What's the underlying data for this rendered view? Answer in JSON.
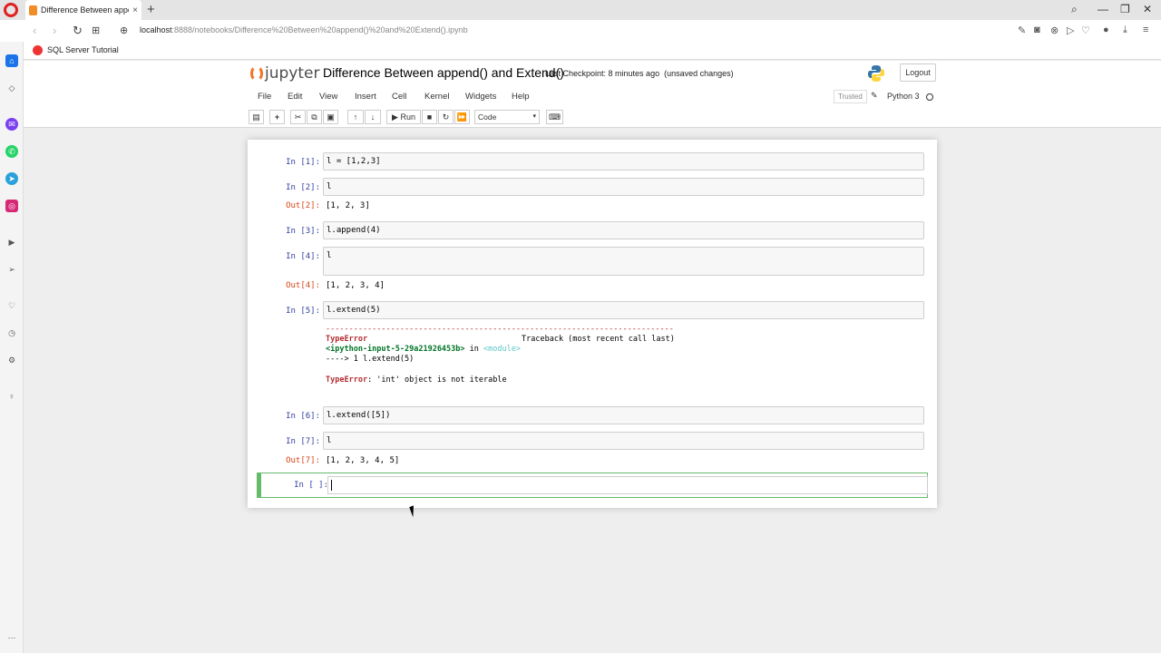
{
  "browser": {
    "tab_title": "Difference Between append",
    "tab_close": "×",
    "new_tab": "+",
    "url_host": "localhost",
    "url_path": ":8888/notebooks/Difference%20Between%20append()%20and%20Extend().ipynb",
    "bookmark": "SQL Server Tutorial",
    "window_controls": [
      "⌕",
      "—",
      "❐",
      "✕"
    ]
  },
  "jupyter": {
    "logo_text": "jupyter",
    "notebook_title": "Difference Between append() and Extend()",
    "checkpoint": "Last Checkpoint: 8 minutes ago",
    "unsaved": "(unsaved changes)",
    "logout_label": "Logout",
    "menu": [
      "File",
      "Edit",
      "View",
      "Insert",
      "Cell",
      "Kernel",
      "Widgets",
      "Help"
    ],
    "trusted_label": "Trusted",
    "kernel_name": "Python 3",
    "run_label": "Run",
    "cell_type": "Code"
  },
  "cells": [
    {
      "prompt": "In [1]:",
      "code": "l = [1,2,3]"
    },
    {
      "prompt": "In [2]:",
      "code": "l",
      "out_prompt": "Out[2]:",
      "output": "[1, 2, 3]"
    },
    {
      "prompt": "In [3]:",
      "code": "l.append(4)"
    },
    {
      "prompt": "In [4]:",
      "code": "l",
      "out_prompt": "Out[4]:",
      "output": "[1, 2, 3, 4]"
    },
    {
      "prompt": "In [5]:",
      "code": "l.extend(5)"
    },
    {
      "prompt": "In [6]:",
      "code": "l.extend([5])"
    },
    {
      "prompt": "In [7]:",
      "code": "l",
      "out_prompt": "Out[7]:",
      "output": "[1, 2, 3, 4, 5]"
    },
    {
      "prompt": "In [ ]:",
      "code": ""
    }
  ],
  "error": {
    "dashes": "---------------------------------------------------------------------------",
    "type": "TypeError",
    "traceback": "Traceback (most recent call last)",
    "location": "<ipython-input-5-29a21926453b>",
    "in_word": " in ",
    "module": "<module>",
    "arrow_line": "----> 1 l.extend(5)",
    "message_type": "TypeError",
    "message": ": 'int' object is not iterable"
  },
  "colors": {
    "in_prompt": "#303f9f",
    "out_prompt": "#d84315",
    "active_cell_border": "#66bb6a",
    "jupyter_orange": "#f37626"
  }
}
